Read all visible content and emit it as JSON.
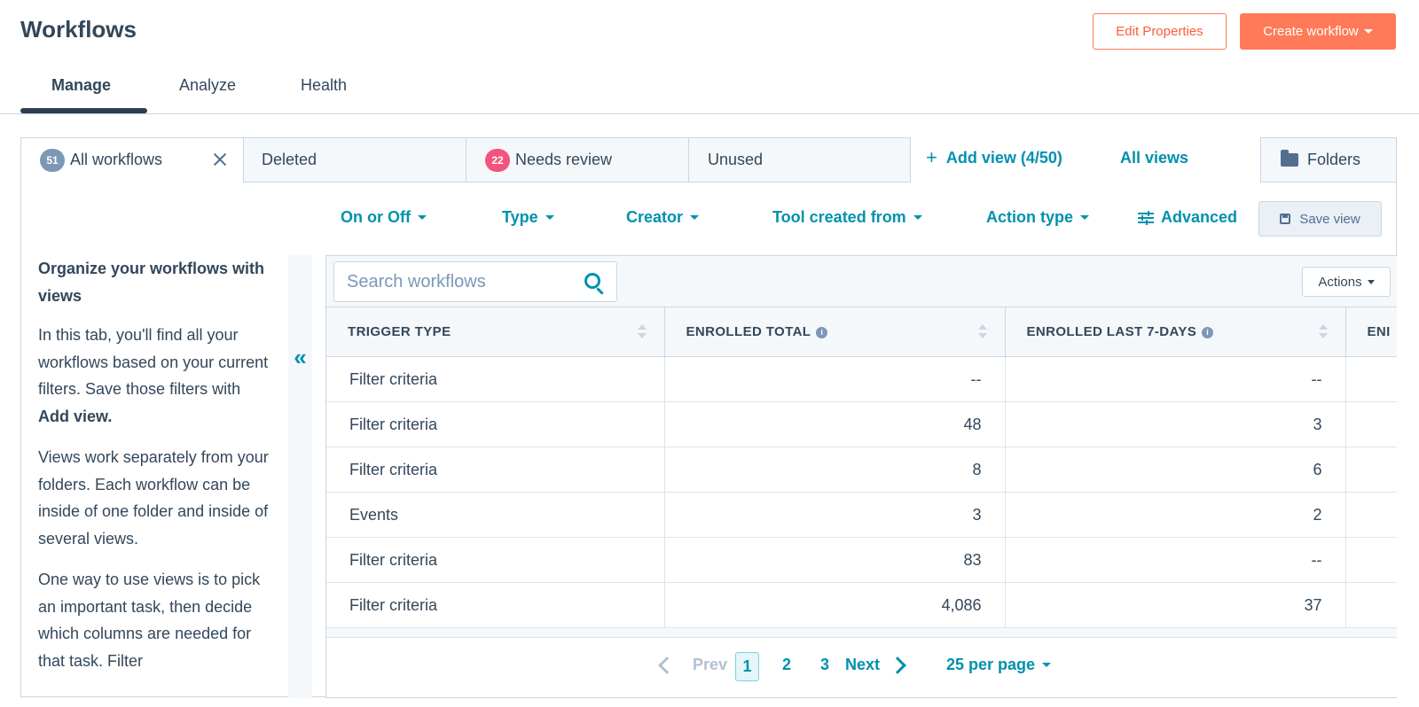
{
  "header": {
    "title": "Workflows",
    "edit_properties_label": "Edit Properties",
    "create_workflow_label": "Create workflow"
  },
  "top_tabs": [
    {
      "label": "Manage",
      "active": true
    },
    {
      "label": "Analyze",
      "active": false
    },
    {
      "label": "Health",
      "active": false
    }
  ],
  "view_tabs": {
    "all_workflows": {
      "label": "All workflows",
      "count": "51"
    },
    "deleted": {
      "label": "Deleted"
    },
    "needs_review": {
      "label": "Needs review",
      "count": "22"
    },
    "unused": {
      "label": "Unused"
    },
    "add_view_label": "Add view (4/50)",
    "all_views_label": "All views",
    "folders_label": "Folders"
  },
  "filters": {
    "on_or_off": "On or Off",
    "type": "Type",
    "creator": "Creator",
    "tool_created_from": "Tool created from",
    "action_type": "Action type",
    "advanced": "Advanced",
    "save_view": "Save view"
  },
  "side_panel": {
    "heading": "Organize your workflows with views",
    "p1_text": "In this tab, you'll find all your workflows based on your current filters. Save those filters with ",
    "p1_bold": "Add view.",
    "p2": "Views work separately from your folders. Each workflow can be inside of one folder and inside of several views.",
    "p3": "One way to use views is to pick an important task, then decide which columns are needed for that task. Filter"
  },
  "search": {
    "placeholder": "Search workflows"
  },
  "actions_label": "Actions",
  "table": {
    "columns": [
      "TRIGGER TYPE",
      "ENROLLED TOTAL",
      "ENROLLED LAST 7-DAYS",
      "ENI"
    ],
    "rows": [
      {
        "trigger": "Filter criteria",
        "total": "--",
        "last7": "--"
      },
      {
        "trigger": "Filter criteria",
        "total": "48",
        "last7": "3"
      },
      {
        "trigger": "Filter criteria",
        "total": "8",
        "last7": "6"
      },
      {
        "trigger": "Events",
        "total": "3",
        "last7": "2"
      },
      {
        "trigger": "Filter criteria",
        "total": "83",
        "last7": "--"
      },
      {
        "trigger": "Filter criteria",
        "total": "4,086",
        "last7": "37"
      }
    ]
  },
  "pagination": {
    "prev": "Prev",
    "pages": [
      "1",
      "2",
      "3"
    ],
    "current": "1",
    "next": "Next",
    "per_page": "25 per page"
  },
  "colors": {
    "accent": "#0091ae",
    "primary_button": "#ff7a59",
    "text": "#33475b",
    "badge_all": "#7c98b6",
    "badge_review": "#f2547d"
  }
}
